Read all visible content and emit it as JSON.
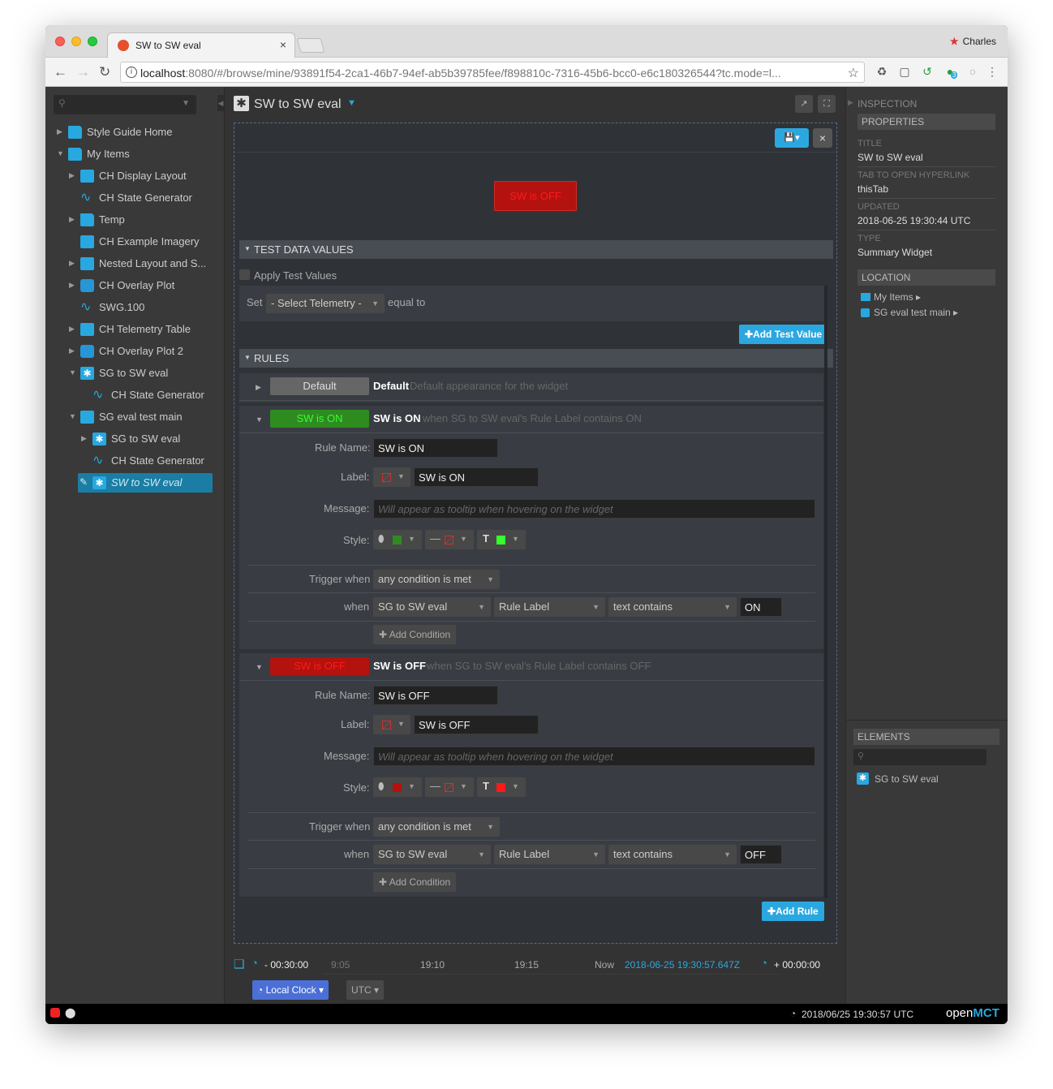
{
  "browser": {
    "tab_title": "SW to SW eval",
    "user": "Charles",
    "url_host": "localhost",
    "url_rest": ":8080/#/browse/mine/93891f54-2ca1-46b7-94ef-ab5b39785fee/f898810c-7316-45b6-bcc0-e6c180326544?tc.mode=l...",
    "ext_badge": "3"
  },
  "tree": [
    {
      "label": "Style Guide Home",
      "icon": "folder-icon",
      "indent": 0,
      "arrow": "right"
    },
    {
      "label": "My Items",
      "icon": "folder-icon",
      "indent": 0,
      "arrow": "down"
    },
    {
      "label": "CH Display Layout",
      "icon": "layout-icon",
      "indent": 1,
      "arrow": "right"
    },
    {
      "label": "CH State Generator",
      "icon": "state-generator-icon",
      "indent": 1,
      "arrow": ""
    },
    {
      "label": "Temp",
      "icon": "folder-icon",
      "indent": 1,
      "arrow": "right"
    },
    {
      "label": "CH Example Imagery",
      "icon": "imagery-icon",
      "indent": 1,
      "arrow": ""
    },
    {
      "label": "Nested Layout and S...",
      "icon": "layout-icon",
      "indent": 1,
      "arrow": "right"
    },
    {
      "label": "CH Overlay Plot",
      "icon": "plot-icon",
      "indent": 1,
      "arrow": "right"
    },
    {
      "label": "SWG.100",
      "icon": "state-generator-icon",
      "indent": 1,
      "arrow": ""
    },
    {
      "label": "CH Telemetry Table",
      "icon": "table-icon",
      "indent": 1,
      "arrow": "right"
    },
    {
      "label": "CH Overlay Plot 2",
      "icon": "plot-icon",
      "indent": 1,
      "arrow": "right"
    },
    {
      "label": "SG to SW eval",
      "icon": "summary-widget-icon",
      "indent": 1,
      "arrow": "down"
    },
    {
      "label": "CH State Generator",
      "icon": "state-generator-icon",
      "indent": 2,
      "arrow": ""
    },
    {
      "label": "SG eval test main",
      "icon": "layout-icon",
      "indent": 1,
      "arrow": "down"
    },
    {
      "label": "SG to SW eval",
      "icon": "summary-widget-icon",
      "indent": 2,
      "arrow": "right"
    },
    {
      "label": "CH State Generator",
      "icon": "state-generator-icon",
      "indent": 2,
      "arrow": ""
    },
    {
      "label": "SW to SW eval",
      "icon": "summary-widget-icon",
      "indent": 2,
      "arrow": "",
      "selected": true
    }
  ],
  "header": {
    "title": "SW to SW eval"
  },
  "widget": {
    "preview_label": "SW is OFF"
  },
  "test_data": {
    "section": "TEST DATA VALUES",
    "apply_label": "Apply Test Values",
    "set_label": "Set",
    "telemetry_select": "- Select Telemetry -",
    "equal_to": "equal to",
    "add_button": "Add Test Value"
  },
  "rules_section": "RULES",
  "default_rule": {
    "chip": "Default",
    "name": "Default",
    "desc": "Default appearance for the widget"
  },
  "labels": {
    "rule_name": "Rule Name:",
    "label": "Label:",
    "message": "Message:",
    "style": "Style:",
    "trigger": "Trigger when",
    "when": "when",
    "message_placeholder": "Will appear as tooltip when hovering on the widget",
    "add_condition": "Add Condition"
  },
  "rule_on": {
    "chip": "SW is ON",
    "name": "SW is ON",
    "desc": "when SG to SW eval's Rule Label contains ON",
    "rule_name_value": "SW is ON",
    "label_value": "SW is ON",
    "trigger": "any condition is met",
    "cond_object": "SG to SW eval",
    "cond_field": "Rule Label",
    "cond_op": "text contains",
    "cond_value": "ON",
    "bg_color": "#2e8b20",
    "text_color": "#35ff2f"
  },
  "rule_off": {
    "chip": "SW is OFF",
    "name": "SW is OFF",
    "desc": "when SG to SW eval's Rule Label contains OFF",
    "rule_name_value": "SW is OFF",
    "label_value": "SW is OFF",
    "trigger": "any condition is met",
    "cond_object": "SG to SW eval",
    "cond_field": "Rule Label",
    "cond_op": "text contains",
    "cond_value": "OFF",
    "bg_color": "#b3120f",
    "text_color": "#ff1a1a"
  },
  "add_rule": "Add Rule",
  "time": {
    "start_offset": "- 00:30:00",
    "ticks": [
      "9:05",
      "19:10",
      "19:15"
    ],
    "now_label": "Now",
    "now_value": "2018-06-25 19:30:57.647Z",
    "end_offset": "+ 00:00:00",
    "clock_button": "Local Clock",
    "tz_button": "UTC"
  },
  "inspector": {
    "title": "INSPECTION",
    "properties": "PROPERTIES",
    "props": [
      {
        "k": "TITLE",
        "v": "SW to SW eval"
      },
      {
        "k": "TAB TO OPEN HYPERLINK",
        "v": "thisTab"
      },
      {
        "k": "UPDATED",
        "v": "2018-06-25 19:30:44 UTC"
      },
      {
        "k": "TYPE",
        "v": "Summary Widget"
      }
    ],
    "location": "LOCATION",
    "location_items": [
      "My Items",
      "SG eval test main"
    ],
    "elements": "ELEMENTS",
    "element_items": [
      "SG to SW eval"
    ]
  },
  "status": {
    "clock": "2018/06/25 19:30:57 UTC",
    "brand_a": "open",
    "brand_b": "MCT"
  },
  "colors": {
    "accent": "#2ba7e0",
    "selection": "#1b7da3"
  }
}
